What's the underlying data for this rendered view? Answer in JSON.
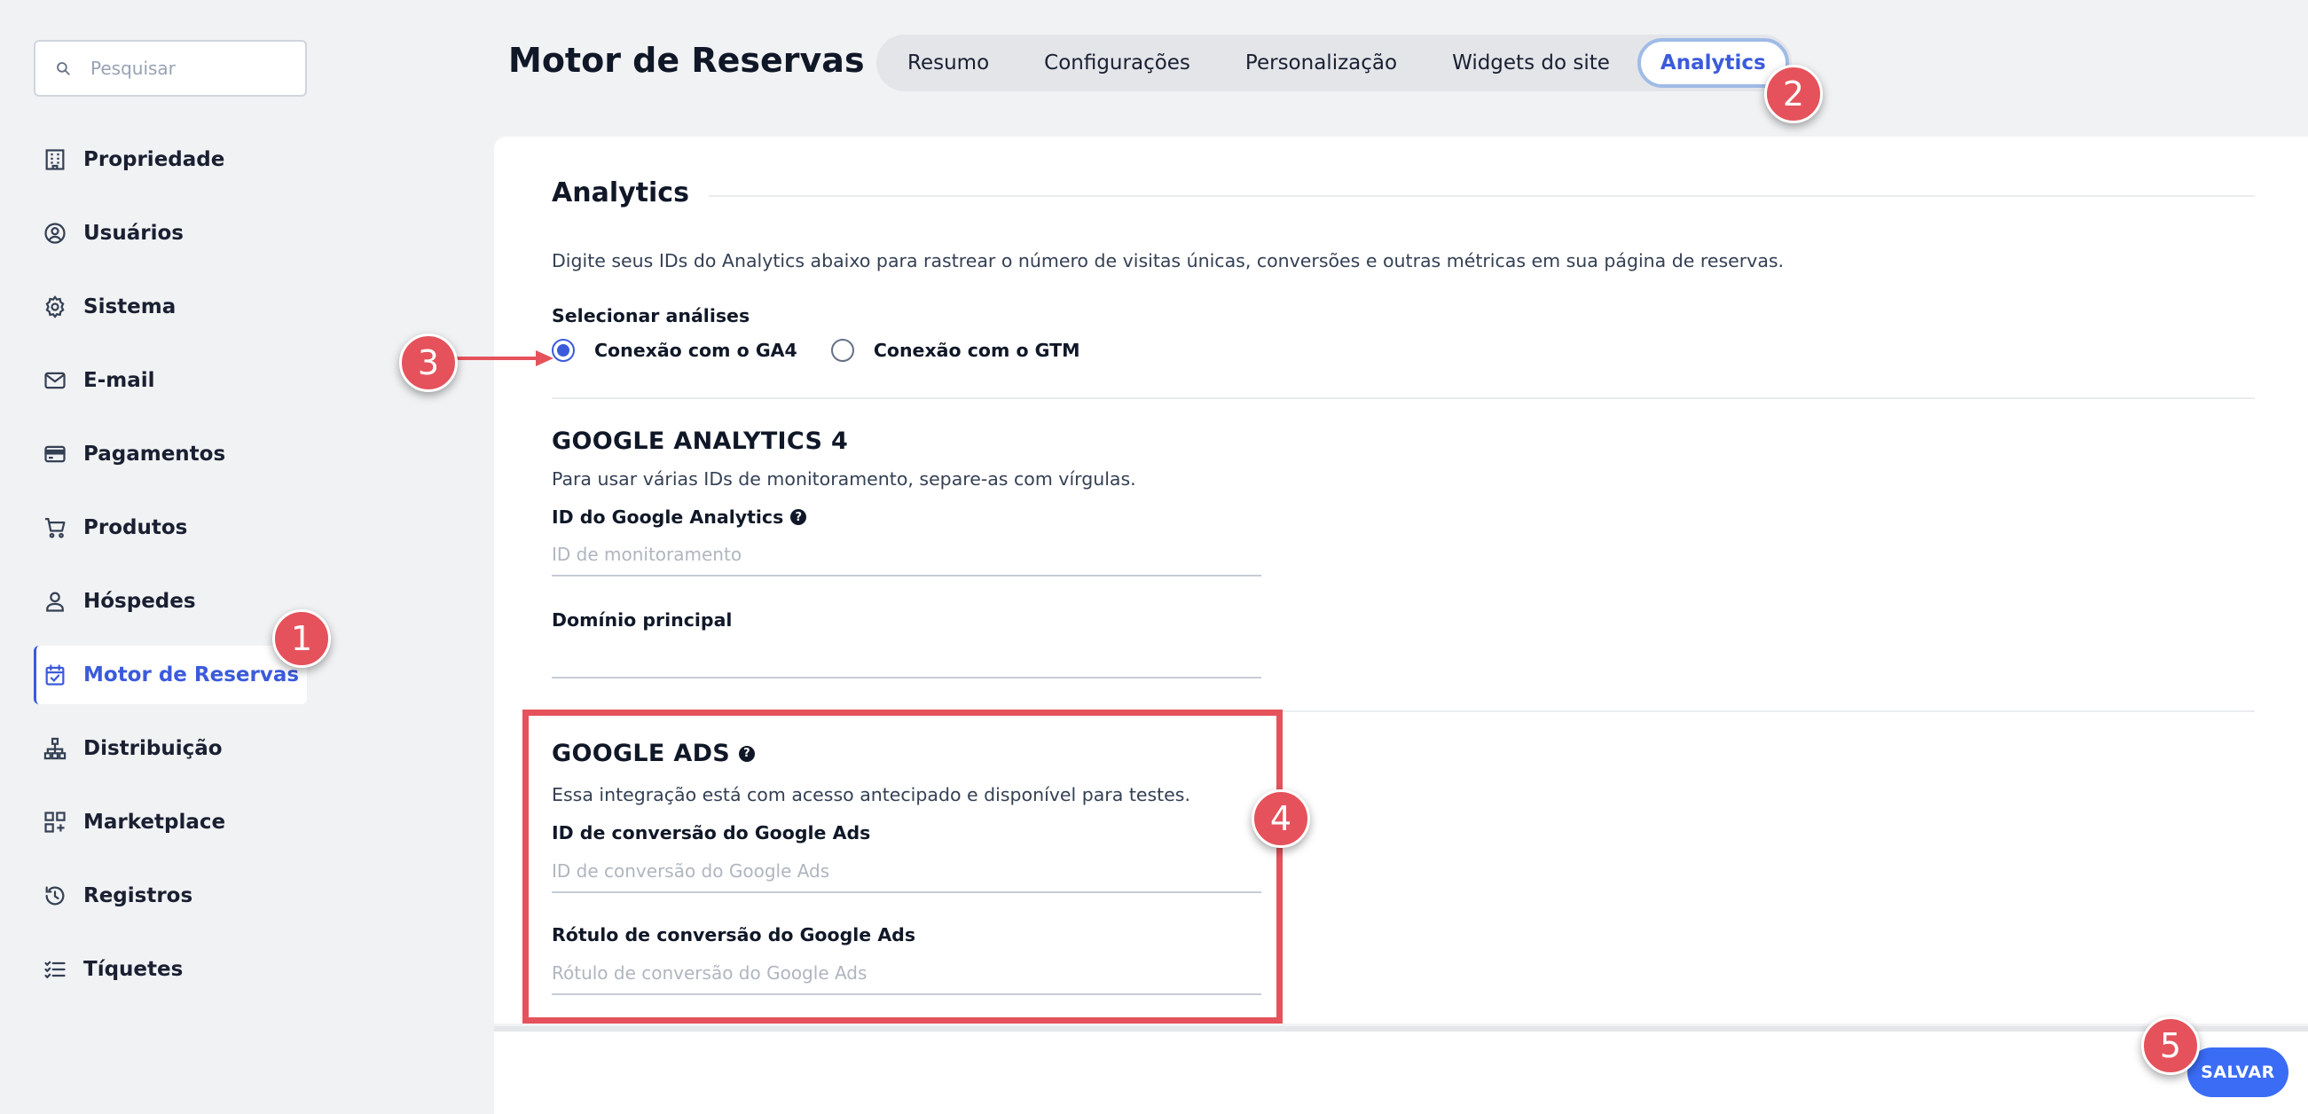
{
  "sidebar": {
    "search_placeholder": "Pesquisar",
    "items": [
      {
        "label": "Propriedade",
        "icon": "building-icon"
      },
      {
        "label": "Usuários",
        "icon": "user-circle-icon"
      },
      {
        "label": "Sistema",
        "icon": "gear-icon"
      },
      {
        "label": "E-mail",
        "icon": "mail-icon"
      },
      {
        "label": "Pagamentos",
        "icon": "credit-card-icon"
      },
      {
        "label": "Produtos",
        "icon": "cart-icon"
      },
      {
        "label": "Hóspedes",
        "icon": "person-icon"
      },
      {
        "label": "Motor de Reservas",
        "icon": "calendar-check-icon",
        "active": true
      },
      {
        "label": "Distribuição",
        "icon": "sitemap-icon"
      },
      {
        "label": "Marketplace",
        "icon": "grid-plus-icon"
      },
      {
        "label": "Registros",
        "icon": "history-icon"
      },
      {
        "label": "Tíquetes",
        "icon": "checklist-icon"
      }
    ]
  },
  "header": {
    "title": "Motor de Reservas",
    "tabs": [
      {
        "label": "Resumo"
      },
      {
        "label": "Configurações"
      },
      {
        "label": "Personalização"
      },
      {
        "label": "Widgets do site"
      },
      {
        "label": "Analytics",
        "active": true
      }
    ]
  },
  "analytics": {
    "title": "Analytics",
    "description": "Digite seus IDs do Analytics abaixo para rastrear o número de visitas únicas, conversões e outras métricas em sua página de reservas.",
    "select_label": "Selecionar análises",
    "options": [
      {
        "label": "Conexão com o GA4",
        "selected": true
      },
      {
        "label": "Conexão com o GTM",
        "selected": false
      }
    ]
  },
  "ga4": {
    "title": "GOOGLE ANALYTICS 4",
    "subtitle": "Para usar várias IDs de monitoramento, separe-as com vírgulas.",
    "id_label": "ID do Google Analytics",
    "id_placeholder": "ID de monitoramento",
    "id_value": "",
    "domain_label": "Domínio principal",
    "domain_value": ""
  },
  "google_ads": {
    "title": "GOOGLE ADS",
    "subtitle": "Essa integração está com acesso antecipado e disponível para testes.",
    "conversion_id_label": "ID de conversão do Google Ads",
    "conversion_id_placeholder": "ID de conversão do Google Ads",
    "conversion_label_label": "Rótulo de conversão do Google Ads",
    "conversion_label_placeholder": "Rótulo de conversão do Google Ads"
  },
  "footer": {
    "save_label": "SALVAR"
  },
  "annotations": {
    "badges": [
      "1",
      "2",
      "3",
      "4",
      "5"
    ],
    "color": "#e5525b"
  },
  "colors": {
    "accent": "#3b5bdb",
    "save_button": "#3b6cf6",
    "background": "#f1f2f4"
  }
}
